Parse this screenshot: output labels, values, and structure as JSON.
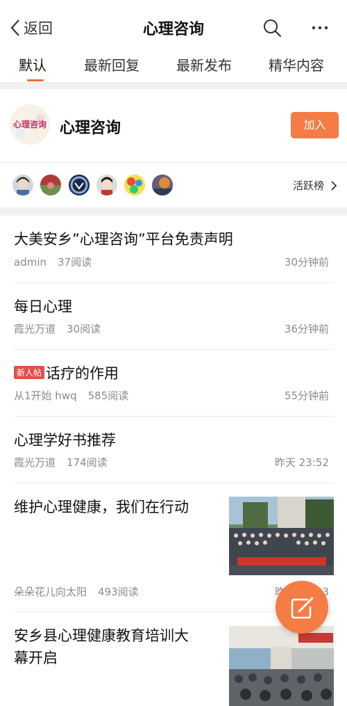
{
  "header": {
    "back_label": "返回",
    "title": "心理咨询"
  },
  "tabs": [
    {
      "label": "默认",
      "active": true
    },
    {
      "label": "最新回复"
    },
    {
      "label": "最新发布"
    },
    {
      "label": "精华内容"
    }
  ],
  "group": {
    "name": "心理咨询",
    "logo_text": "心理咨询",
    "join_label": "加入"
  },
  "active_users": {
    "rank_label": "活跃榜"
  },
  "posts": [
    {
      "title": "大美安乡”心理咨询”平台免责声明",
      "author": "admin",
      "reads": "37阅读",
      "time": "30分钟前"
    },
    {
      "title": "每日心理",
      "author": "霞光万道",
      "reads": "30阅读",
      "time": "36分钟前"
    },
    {
      "badge": "新人帖",
      "title": "话疗的作用",
      "author": "从1开始 hwq",
      "reads": "585阅读",
      "time": "55分钟前"
    },
    {
      "title": "心理学好书推荐",
      "author": "霞光万道",
      "reads": "174阅读",
      "time": "昨天 23:52"
    },
    {
      "title": "维护心理健康，我们在行动",
      "author": "朵朵花儿向太阳",
      "reads": "493阅读",
      "time": "昨天 23:03"
    },
    {
      "title_line1": "安乡县心理健康教育培训大",
      "title_line2": "幕开启"
    }
  ],
  "colors": {
    "accent": "#f47c45",
    "badge": "#e1504a"
  }
}
